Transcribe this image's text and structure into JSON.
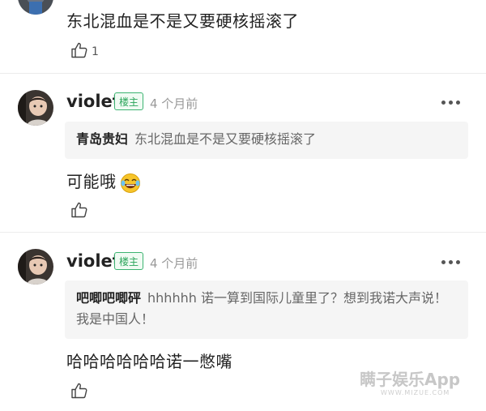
{
  "comment0": {
    "text": "东北混血是不是又要硬核摇滚了",
    "like_count": "1"
  },
  "reply1": {
    "username": "violet",
    "badge": "楼主",
    "time": "4 个月前",
    "quote_name": "青岛贵妇",
    "quote_text": "东北混血是不是又要硬核摇滚了",
    "text": "可能哦",
    "emoji": "laughing-tears-emoji"
  },
  "reply2": {
    "username": "violet",
    "badge": "楼主",
    "time": "4 个月前",
    "quote_name": "吧唧吧唧砰",
    "quote_text": "hhhhhh 诺一算到国际儿童里了？想到我诺大声说！我是中国人！",
    "text": "哈哈哈哈哈哈诺一憋嘴"
  },
  "watermark": {
    "text": "瞒子娱乐App",
    "sub": "WWW.MIZUE.COM"
  },
  "icons": [
    "thumbs-up-icon",
    "more-dots-icon"
  ],
  "colors": {
    "badge_green": "#2aa55a",
    "time_gray": "#999999",
    "quote_bg": "#f5f5f5"
  }
}
